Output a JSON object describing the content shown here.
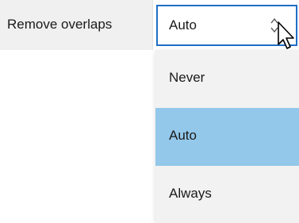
{
  "row": {
    "label": "Remove overlaps",
    "combo_value": "Auto",
    "combo_icon": "up-down-arrows-icon"
  },
  "dropdown": {
    "options": [
      {
        "label": "Never",
        "selected": false
      },
      {
        "label": "Auto",
        "selected": true
      },
      {
        "label": "Always",
        "selected": false
      }
    ]
  },
  "colors": {
    "accent_border": "#1f6fc5",
    "selected_bg": "#94c8ea",
    "dropdown_bg": "#f2f2f2",
    "label_bg": "#f0f0f0"
  }
}
